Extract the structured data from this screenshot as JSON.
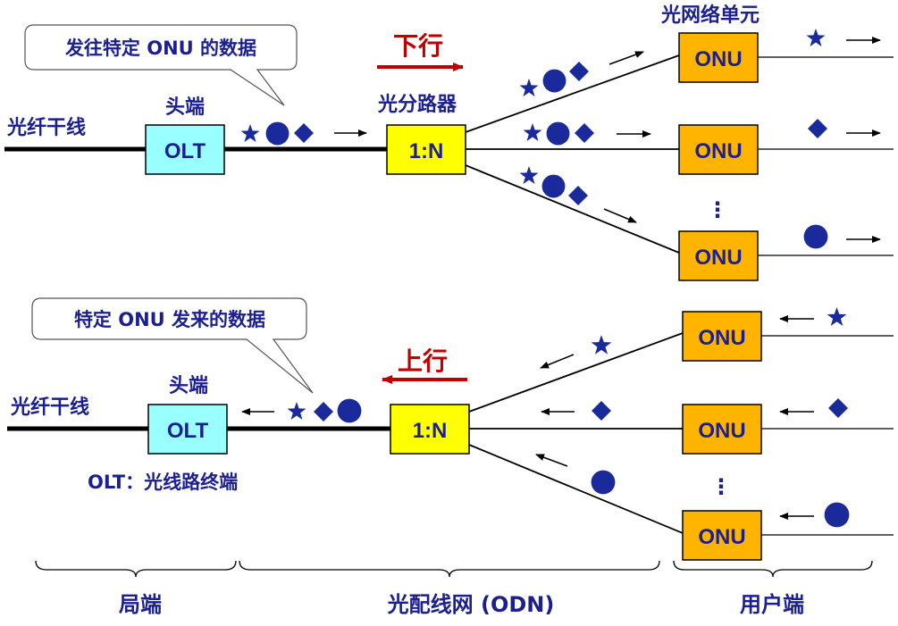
{
  "colors": {
    "text": "#1b1f8f",
    "symbol": "#1b2a9a",
    "olt_fill": "#99ffff",
    "splitter_fill": "#ffff00",
    "onu_fill": "#ffb400",
    "direction_arrow": "#c00000"
  },
  "downstream": {
    "fiber_label": "光纤干线",
    "head_label": "头端",
    "olt_label": "OLT",
    "callout": "发往特定 ONU 的数据",
    "direction": "下行",
    "splitter_title": "光分路器",
    "splitter_label": "1:N",
    "onu_title": "光网络单元",
    "onu_label": "ONU",
    "vertical_dots": "⋮",
    "onu_outputs": [
      "star",
      "diamond",
      "circle"
    ]
  },
  "upstream": {
    "fiber_label": "光纤干线",
    "head_label": "头端",
    "olt_label": "OLT",
    "callout": "特定 ONU 发来的数据",
    "direction": "上行",
    "splitter_label": "1:N",
    "onu_label": "ONU",
    "vertical_dots": "⋮",
    "olt_note": "OLT：光线路终端",
    "onu_inputs": [
      "star",
      "diamond",
      "circle"
    ]
  },
  "sections": {
    "office": "局端",
    "odn": "光配线网 (ODN)",
    "user": "用户端"
  }
}
